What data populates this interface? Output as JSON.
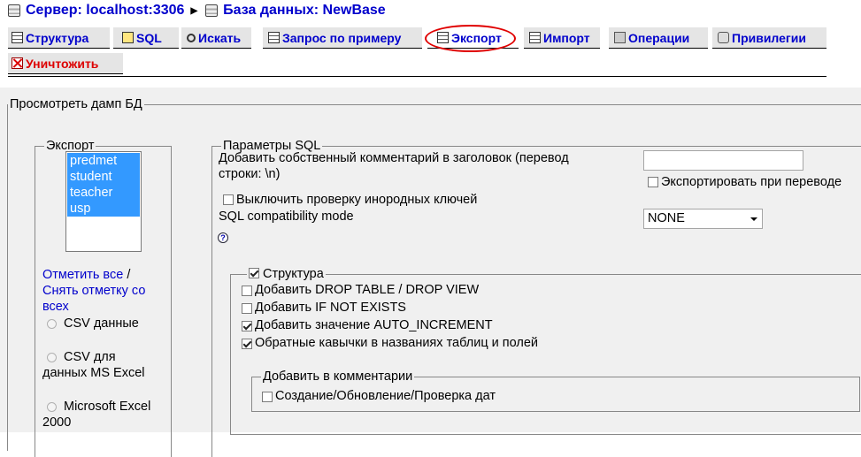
{
  "breadcrumb": {
    "server": "Сервер: localhost:3306",
    "database": "База данных: NewBase"
  },
  "tabs": [
    {
      "label": "Структура",
      "icon": "structure-icon"
    },
    {
      "label": "SQL",
      "icon": "sql-icon"
    },
    {
      "label": "Искать",
      "icon": "search-icon"
    },
    {
      "label": "Запрос по примеру",
      "icon": "query-icon"
    },
    {
      "label": "Экспорт",
      "icon": "export-icon",
      "active": true
    },
    {
      "label": "Импорт",
      "icon": "import-icon"
    },
    {
      "label": "Операции",
      "icon": "operations-icon"
    },
    {
      "label": "Привилегии",
      "icon": "privileges-icon"
    },
    {
      "label": "Уничтожить",
      "icon": "drop-icon"
    }
  ],
  "colors": {
    "link": "#0000cc",
    "danger": "#dd0000",
    "highlight_ring": "#e00000",
    "selection": "#3399ff"
  },
  "dump": {
    "legend": "Просмотреть дамп БД",
    "export": {
      "legend": "Экспорт",
      "tables": [
        "predmet",
        "student",
        "teacher",
        "usp"
      ],
      "select_all": "Отметить все",
      "separator": "/",
      "unselect_all_line1": "Снять отметку со",
      "unselect_all_line2": "всех",
      "formats": {
        "csv": "CSV данные",
        "csv_excel_line1": "CSV для",
        "csv_excel_line2": "данных MS Excel",
        "excel_line1": "Microsoft Excel",
        "excel_line2": "2000"
      }
    },
    "sql": {
      "legend": "Параметры SQL",
      "comment_label_line1": "Добавить собственный комментарий в заголовок (перевод",
      "comment_label_line2": "строки: \\n)",
      "comment_value": "",
      "export_on_translate": "Экспортировать при переводе",
      "disable_fk": "Выключить проверку инородных ключей",
      "compat_label": "SQL compatibility mode",
      "compat_value": "NONE",
      "help": "?",
      "structure": {
        "legend": "Структура",
        "drop_table": "Добавить DROP TABLE / DROP VIEW",
        "if_not_exists": "Добавить IF NOT EXISTS",
        "auto_increment": "Добавить значение AUTO_INCREMENT",
        "backquotes": "Обратные кавычки в названиях таблиц и полей",
        "comments": {
          "legend": "Добавить в комментарии",
          "dates": "Создание/Обновление/Проверка дат"
        }
      }
    }
  }
}
